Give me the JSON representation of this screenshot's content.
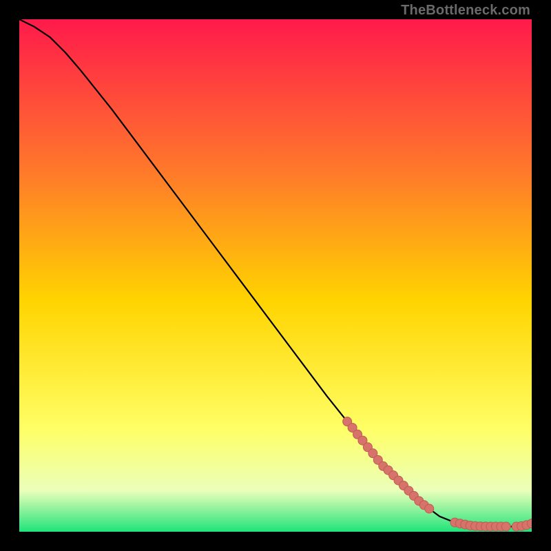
{
  "watermark": "TheBottleneck.com",
  "colors": {
    "background": "#000000",
    "gradient_top": "#ff1a4b",
    "gradient_mid1": "#ff7a2a",
    "gradient_mid2": "#ffd400",
    "gradient_mid3": "#ffff66",
    "gradient_mid4": "#eaffba",
    "gradient_bottom": "#20e37a",
    "curve": "#000000",
    "marker_fill": "#d6736b",
    "marker_stroke": "#c25a52"
  },
  "chart_data": {
    "type": "line",
    "title": "",
    "xlabel": "",
    "ylabel": "",
    "xlim": [
      0,
      100
    ],
    "ylim": [
      0,
      100
    ],
    "curve": {
      "x": [
        0,
        3,
        6,
        9,
        12,
        18,
        24,
        30,
        36,
        42,
        48,
        54,
        60,
        66,
        72,
        78,
        82,
        85,
        88,
        92,
        96,
        100
      ],
      "y": [
        100,
        98.5,
        96.5,
        93.5,
        90,
        82.5,
        74.5,
        66.5,
        58.5,
        50.5,
        42.5,
        34.5,
        26.5,
        19,
        12,
        6,
        3,
        1.8,
        1.2,
        1,
        1,
        1.5
      ]
    },
    "markers": {
      "x": [
        64,
        65,
        66,
        67,
        68,
        69,
        70,
        71,
        72,
        73,
        74,
        75,
        76,
        77,
        78,
        79,
        80,
        85,
        86,
        87,
        88,
        89,
        90,
        91,
        92,
        93,
        94,
        95,
        97,
        98,
        99,
        100
      ],
      "y": [
        21.5,
        20.3,
        19,
        17.8,
        16.5,
        15.3,
        14,
        12.8,
        12,
        11,
        10,
        9,
        8,
        7,
        6,
        5.2,
        4.5,
        1.8,
        1.6,
        1.4,
        1.2,
        1.1,
        1.05,
        1.02,
        1,
        1,
        1,
        1,
        1,
        1.1,
        1.3,
        1.6
      ]
    }
  }
}
